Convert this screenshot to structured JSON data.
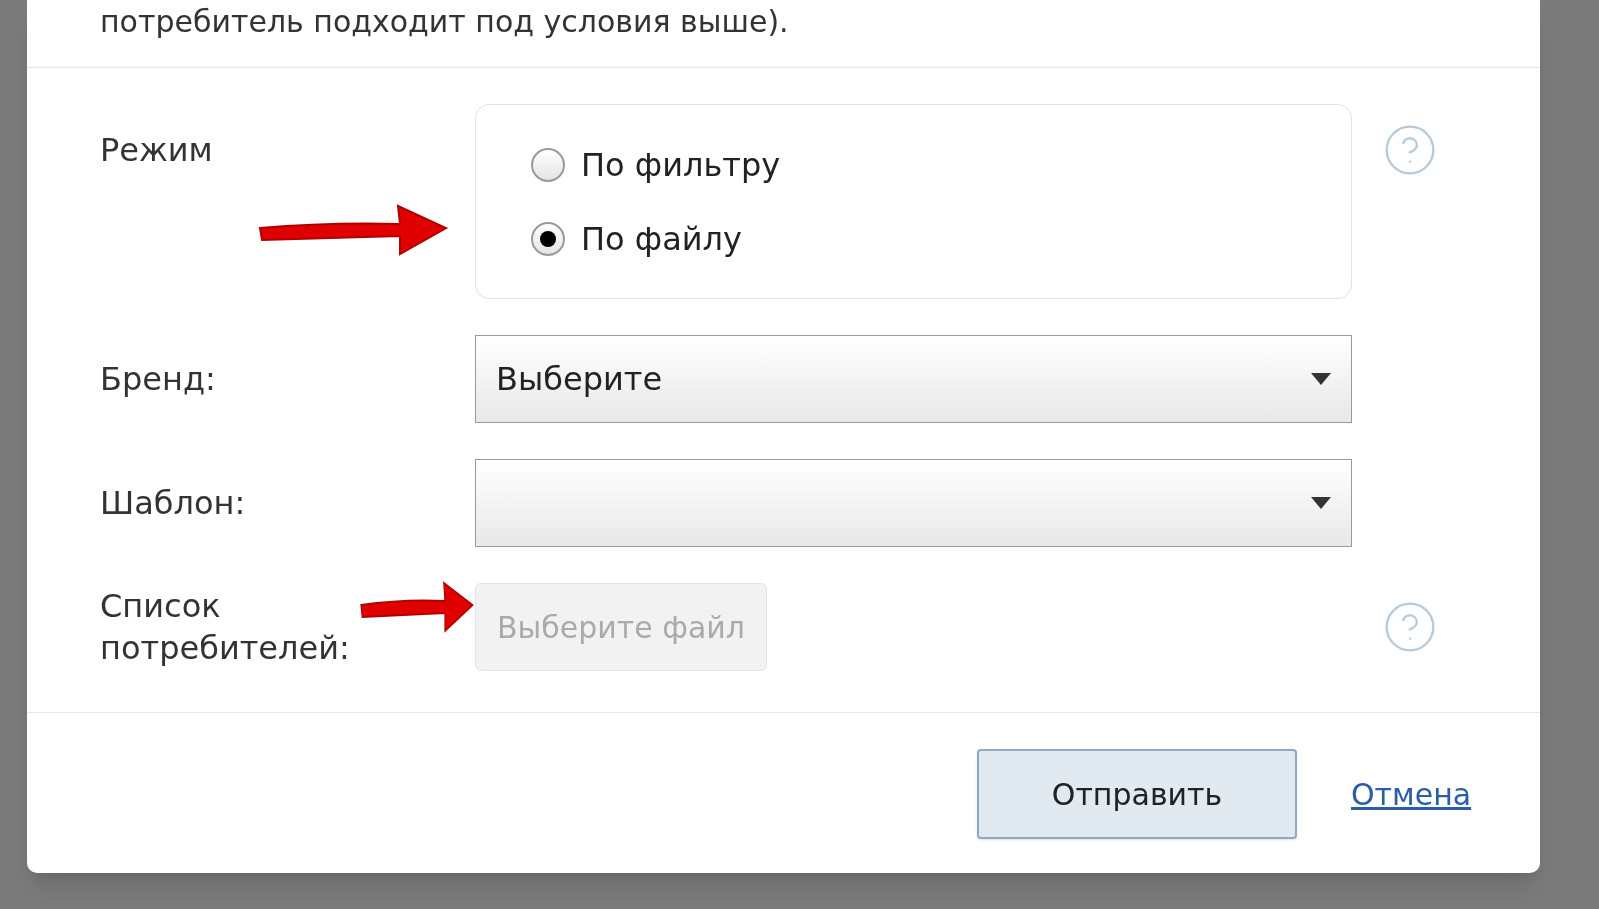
{
  "intro_text": "потребитель подходит под условия выше).",
  "mode": {
    "label": "Режим",
    "options": [
      {
        "label": "По фильтру",
        "selected": false
      },
      {
        "label": "По файлу",
        "selected": true
      }
    ]
  },
  "brand": {
    "label": "Бренд:",
    "value": "Выберите"
  },
  "template": {
    "label": "Шаблон:"
  },
  "consumer_list": {
    "label": "Список потребителей:",
    "button": "Выберите файл"
  },
  "footer": {
    "submit": "Отправить",
    "cancel": "Отмена"
  }
}
